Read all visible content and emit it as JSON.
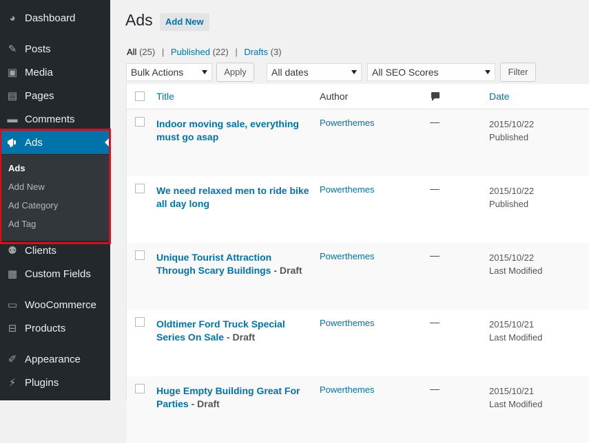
{
  "sidebar": {
    "items": [
      {
        "label": "Dashboard",
        "icon": "dashboard-icon",
        "glyph": "◕"
      },
      {
        "label": "Posts",
        "icon": "pushpin-icon",
        "glyph": "✎"
      },
      {
        "label": "Media",
        "icon": "media-icon",
        "glyph": "▣"
      },
      {
        "label": "Pages",
        "icon": "pages-icon",
        "glyph": "▤"
      },
      {
        "label": "Comments",
        "icon": "comments-icon",
        "glyph": "▬"
      },
      {
        "label": "Ads",
        "icon": "megaphone-icon",
        "glyph": "📢"
      },
      {
        "label": "Clients",
        "icon": "users-icon",
        "glyph": "⚉"
      },
      {
        "label": "Custom Fields",
        "icon": "grid-icon",
        "glyph": "▦"
      },
      {
        "label": "WooCommerce",
        "icon": "woocommerce-icon",
        "glyph": "▭"
      },
      {
        "label": "Products",
        "icon": "cart-icon",
        "glyph": "⊟"
      },
      {
        "label": "Appearance",
        "icon": "brush-icon",
        "glyph": "✐"
      },
      {
        "label": "Plugins",
        "icon": "plug-icon",
        "glyph": "⚡"
      }
    ],
    "submenu": [
      "Ads",
      "Add New",
      "Ad Category",
      "Ad Tag"
    ]
  },
  "header": {
    "title": "Ads",
    "add_new": "Add New"
  },
  "filters": {
    "all": "All",
    "all_count": "(25)",
    "published": "Published",
    "published_count": "(22)",
    "drafts": "Drafts",
    "drafts_count": "(3)",
    "sep": "|"
  },
  "toolbar": {
    "bulk_actions": "Bulk Actions",
    "apply": "Apply",
    "all_dates": "All dates",
    "seo_scores": "All SEO Scores",
    "filter": "Filter"
  },
  "table": {
    "columns": {
      "title": "Title",
      "author": "Author",
      "comments_icon": "comment-bubble-icon",
      "date": "Date"
    },
    "rows": [
      {
        "title": "Indoor moving sale, everything must go asap",
        "state": "",
        "author": "Powerthemes",
        "comments": "—",
        "date": "2015/10/22",
        "status": "Published"
      },
      {
        "title": "We need relaxed men to ride bike all day long",
        "state": "",
        "author": "Powerthemes",
        "comments": "—",
        "date": "2015/10/22",
        "status": "Published"
      },
      {
        "title": "Unique Tourist Attraction Through Scary Buildings",
        "state": " - Draft",
        "author": "Powerthemes",
        "comments": "—",
        "date": "2015/10/22",
        "status": "Last Modified"
      },
      {
        "title": "Oldtimer Ford Truck Special Series On Sale",
        "state": " - Draft",
        "author": "Powerthemes",
        "comments": "—",
        "date": "2015/10/21",
        "status": "Last Modified"
      },
      {
        "title": "Huge Empty Building Great For Parties",
        "state": " - Draft",
        "author": "Powerthemes",
        "comments": "—",
        "date": "2015/10/21",
        "status": "Last Modified"
      }
    ]
  },
  "colors": {
    "accent": "#0073aa",
    "sidebar_bg": "#23282d",
    "highlight": "#e00b16"
  }
}
